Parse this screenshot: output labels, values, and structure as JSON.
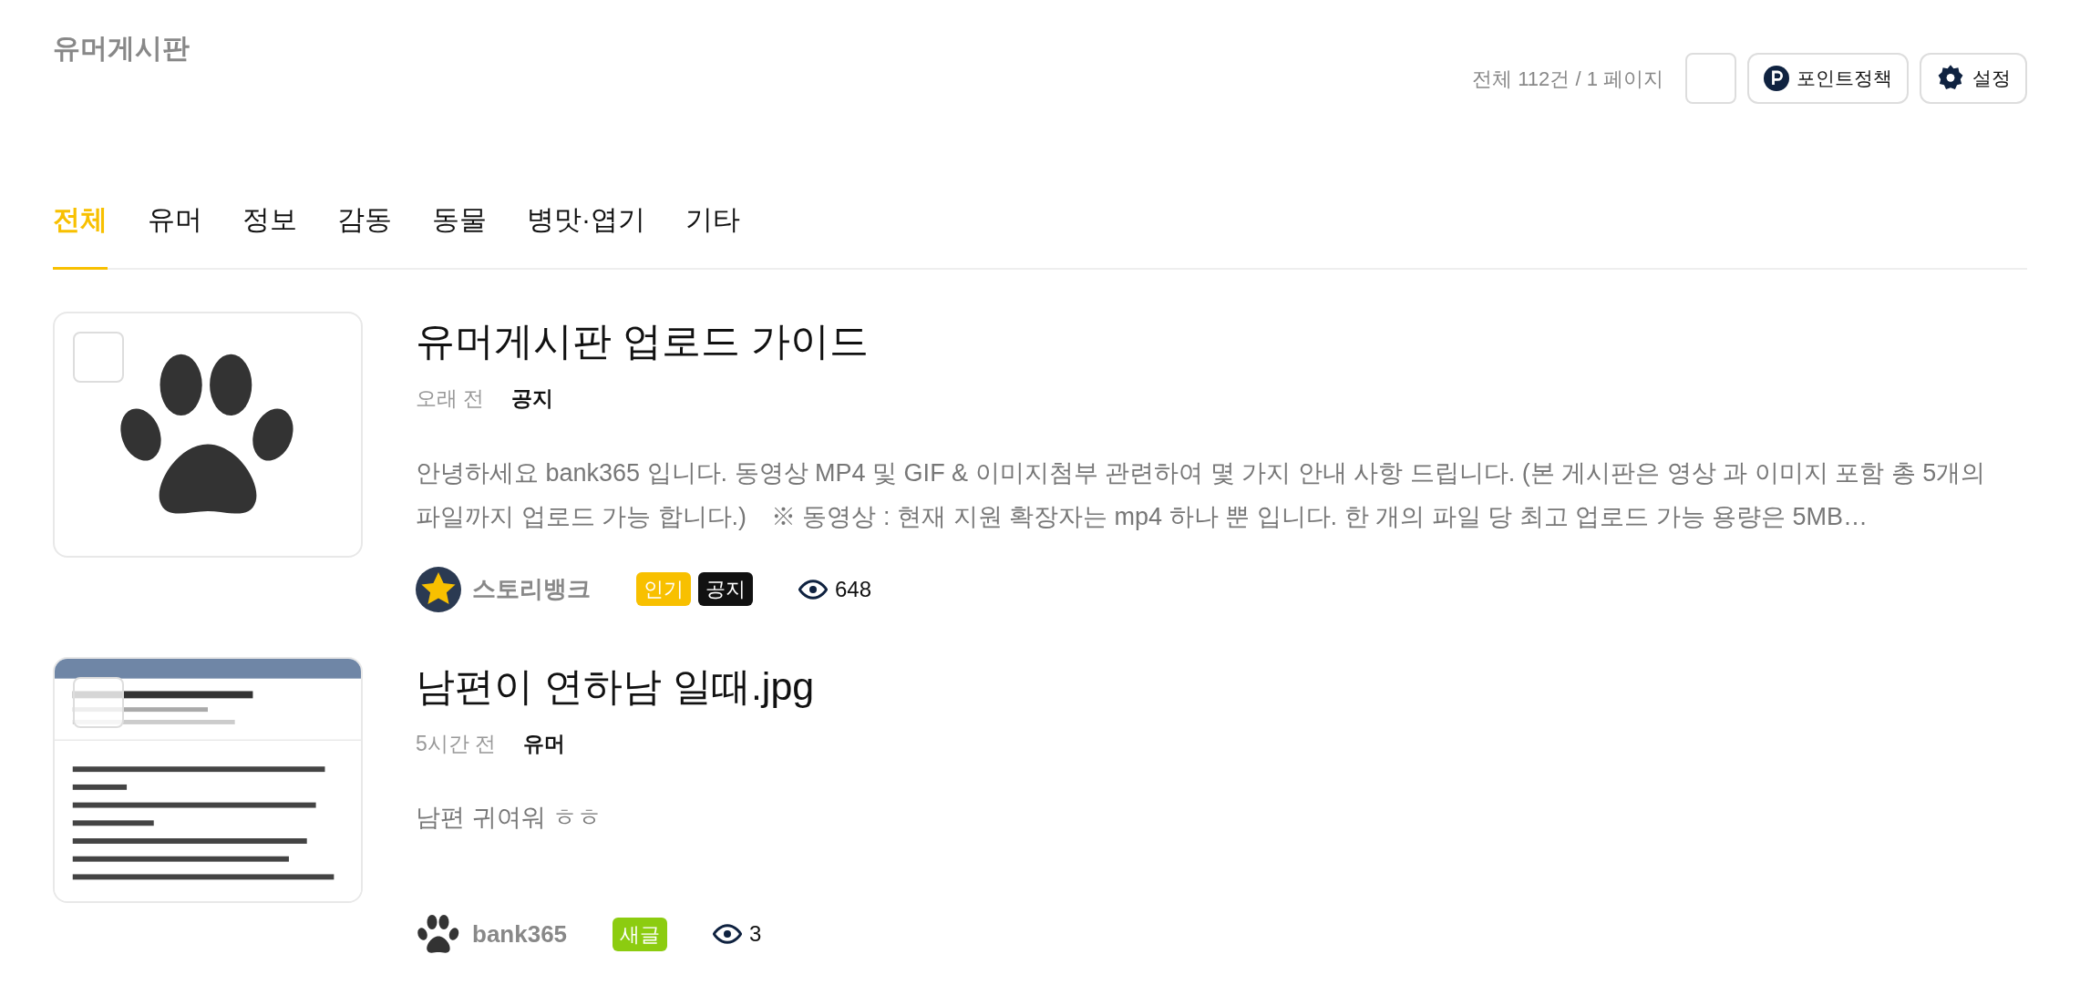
{
  "board": {
    "title": "유머게시판",
    "summary": "전체 112건 / 1 페이지",
    "select_all": {
      "checked": false
    },
    "buttons": [
      {
        "kind": "points",
        "label": "포인트정책"
      },
      {
        "kind": "settings",
        "label": "설정"
      }
    ]
  },
  "tabs": [
    {
      "label": "전체",
      "selected": true
    },
    {
      "label": "유머",
      "selected": false
    },
    {
      "label": "정보",
      "selected": false
    },
    {
      "label": "감동",
      "selected": false
    },
    {
      "label": "동물",
      "selected": false
    },
    {
      "label": "병맛·엽기",
      "selected": false
    },
    {
      "label": "기타",
      "selected": false
    }
  ],
  "posts": [
    {
      "thumbnail": {
        "kind": "paw"
      },
      "checked": false,
      "title": "유머게시판 업로드 가이드",
      "time": "오래 전",
      "category": "공지",
      "excerpt": "안녕하세요 bank365 입니다. 동영상 MP4 및 GIF & 이미지첨부 관련하여 몇 가지 안내 사항 드립니다. (본 게시판은 영상 과 이미지 포함 총 5개의 파일까지 업로드 가능 합니다.)　※ 동영상 : 현재 지원 확장자는 mp4 하나 뿐 입니다. 한 개의 파일 당 최고 업로드 가능 용량은 5MB…",
      "avatar": {
        "kind": "star"
      },
      "author": "스토리뱅크",
      "badges": [
        {
          "label": "인기",
          "color": "#f8c000"
        },
        {
          "label": "공지",
          "color": "#111111"
        }
      ],
      "views": "648"
    },
    {
      "thumbnail": {
        "kind": "picture"
      },
      "checked": false,
      "title": "남편이 연하남 일때.jpg",
      "time": "5시간 전",
      "category": "유머",
      "excerpt": "남편 귀여워 ㅎㅎ",
      "avatar": {
        "kind": "paw"
      },
      "author": "bank365",
      "badges": [
        {
          "label": "새글",
          "color": "#8ccc10"
        }
      ],
      "views": "3"
    }
  ]
}
